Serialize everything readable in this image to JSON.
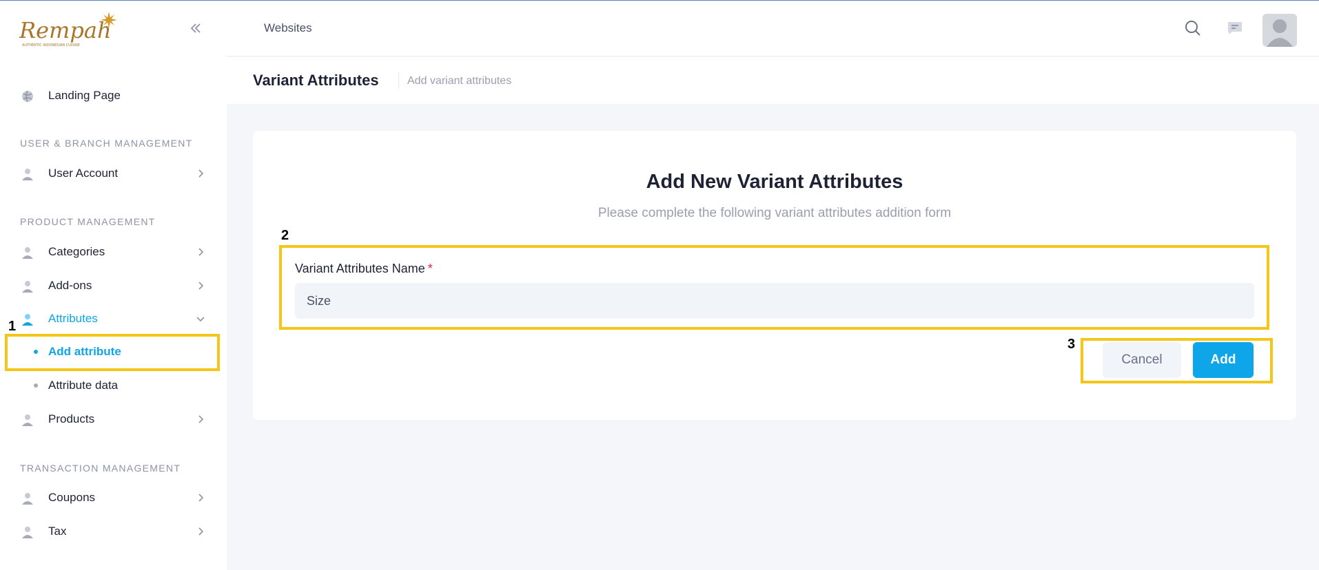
{
  "colors": {
    "accent": "#0ea5e9",
    "annotation": "#f5c518",
    "required": "#e11d48"
  },
  "sidebar": {
    "logo_text": "Rempah",
    "logo_tagline": "AUTHENTIC INDONESIAN CUISINE",
    "landing": {
      "label": "Landing Page",
      "icon": "globe-icon"
    },
    "sections": {
      "user_branch": "USER & BRANCH MANAGEMENT",
      "product": "PRODUCT MANAGEMENT",
      "transaction": "TRANSACTION MANAGEMENT"
    },
    "items": {
      "user_account": "User Account",
      "categories": "Categories",
      "addons": "Add-ons",
      "attributes": "Attributes",
      "products": "Products",
      "coupons": "Coupons",
      "tax": "Tax"
    },
    "sub_items": {
      "add_attribute": "Add attribute",
      "attribute_data": "Attribute data"
    }
  },
  "header": {
    "breadcrumb": "Websites"
  },
  "titlebar": {
    "title": "Variant Attributes",
    "subtitle": "Add variant attributes"
  },
  "form": {
    "title": "Add New Variant Attributes",
    "subtitle": "Please complete the following variant attributes addition form",
    "field_label": "Variant Attributes Name",
    "required_mark": "*",
    "field_value": "Size",
    "cancel_label": "Cancel",
    "add_label": "Add"
  },
  "annotations": {
    "n1": "1",
    "n2": "2",
    "n3": "3"
  }
}
